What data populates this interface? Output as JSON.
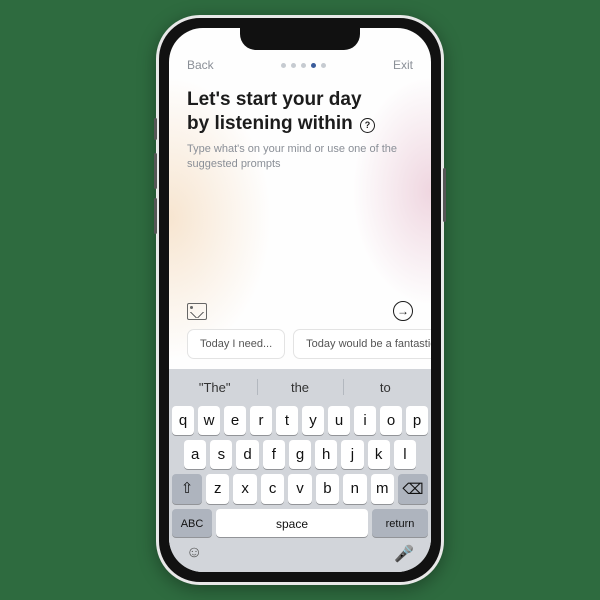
{
  "nav": {
    "back": "Back",
    "exit": "Exit",
    "step_count": 5,
    "active_step": 3
  },
  "title": {
    "line1": "Let's start your day",
    "line2": "by listening within",
    "help_glyph": "?"
  },
  "subtitle": "Type what's on your mind or use one of the suggested prompts",
  "actions": {
    "image_icon": "image-icon",
    "submit_icon": "→"
  },
  "prompts": [
    "Today I need...",
    "Today would be a fantastic"
  ],
  "keyboard": {
    "suggestions": [
      "\"The\"",
      "the",
      "to"
    ],
    "row1": [
      "q",
      "w",
      "e",
      "r",
      "t",
      "y",
      "u",
      "i",
      "o",
      "p"
    ],
    "row2": [
      "a",
      "s",
      "d",
      "f",
      "g",
      "h",
      "j",
      "k",
      "l"
    ],
    "row3": [
      "z",
      "x",
      "c",
      "v",
      "b",
      "n",
      "m"
    ],
    "shift": "⇧",
    "backspace": "⌫",
    "abc": "ABC",
    "space": "space",
    "return": "return",
    "emoji": "☺",
    "mic": "🎤"
  }
}
